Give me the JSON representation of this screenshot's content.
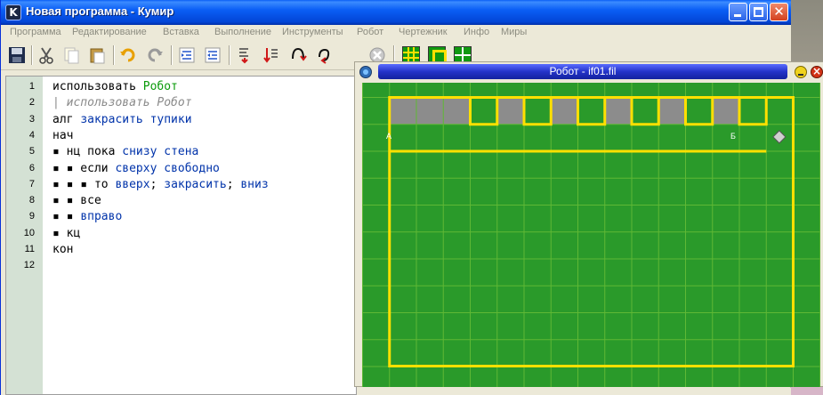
{
  "window": {
    "app_icon_letter": "K",
    "title": "Новая программа - Кумир"
  },
  "menu": [
    {
      "label": "Программа"
    },
    {
      "label": "Редактирование"
    },
    {
      "label": "Вставка"
    },
    {
      "label": "Выполнение"
    },
    {
      "label": "Инструменты"
    },
    {
      "label": "Робот"
    },
    {
      "label": "Чертежник"
    },
    {
      "label": "Инфо"
    },
    {
      "label": "Миры"
    }
  ],
  "toolbar": {
    "icons": [
      "save-icon",
      "cut-icon",
      "copy-icon",
      "paste-icon",
      "undo-icon",
      "redo-icon",
      "indent-icon",
      "unindent-icon",
      "step-in-icon",
      "run-icon",
      "step-over-icon",
      "step-out-icon",
      "stop-icon",
      "robot-grid-icon",
      "robot-cell-icon",
      "drawer-grid-icon"
    ]
  },
  "editor": {
    "line_numbers": [
      "1",
      "2",
      "3",
      "4",
      "5",
      "6",
      "7",
      "8",
      "9",
      "10",
      "11",
      "12"
    ],
    "lines": [
      [
        {
          "t": "использовать ",
          "c": "plain"
        },
        {
          "t": "Робот",
          "c": "green"
        }
      ],
      [
        {
          "t": "| использовать Робот",
          "c": "comment"
        }
      ],
      [
        {
          "t": "алг ",
          "c": "plain"
        },
        {
          "t": "закрасить тупики",
          "c": "blue"
        }
      ],
      [
        {
          "t": "нач",
          "c": "plain"
        }
      ],
      [
        {
          "t": "▪ нц пока ",
          "c": "plain"
        },
        {
          "t": "снизу стена",
          "c": "blue"
        }
      ],
      [
        {
          "t": "▪ ▪ если ",
          "c": "plain"
        },
        {
          "t": "сверху свободно",
          "c": "blue"
        }
      ],
      [
        {
          "t": "▪ ▪ ▪ то ",
          "c": "plain"
        },
        {
          "t": "вверх",
          "c": "blue"
        },
        {
          "t": "; ",
          "c": "plain"
        },
        {
          "t": "закрасить",
          "c": "blue"
        },
        {
          "t": "; ",
          "c": "plain"
        },
        {
          "t": "вниз",
          "c": "blue"
        }
      ],
      [
        {
          "t": "▪ ▪ все",
          "c": "plain"
        }
      ],
      [
        {
          "t": "▪ ▪ ",
          "c": "plain"
        },
        {
          "t": "вправо",
          "c": "blue"
        }
      ],
      [
        {
          "t": "▪ кц",
          "c": "plain"
        }
      ],
      [
        {
          "t": "кон",
          "c": "plain"
        }
      ],
      [
        {
          "t": "",
          "c": "plain"
        }
      ]
    ]
  },
  "robot_window": {
    "title": "Робот - if01.fil",
    "label_a": "А",
    "label_b": "Б",
    "colors": {
      "field": "#2a9a2a",
      "grid": "#5fb835",
      "wall": "#ffe000",
      "painted": "#8c8c8c",
      "robot": "#d0d0d0"
    },
    "grid_cols": 17,
    "grid_rows": 11,
    "painted_cells": [
      1,
      2,
      3,
      5,
      7,
      9,
      11,
      13
    ],
    "dead_end_cells": [
      4,
      6,
      8,
      10,
      12,
      14
    ],
    "robot_cell": 15
  },
  "palette": {
    "title_blue": "#0a5ef5",
    "robot_title_blue": "#2433c9",
    "keyword_green": "#0a9a0a",
    "keyword_blue": "#0033aa"
  }
}
